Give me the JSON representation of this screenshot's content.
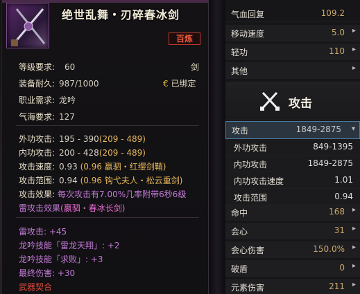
{
  "item": {
    "title": "绝世乱舞・刃碎春冰剑",
    "badge": "百炼",
    "icon": "crossed-swords-icon",
    "level_req_label": "等级要求:",
    "level_req_value": "60",
    "weapon_type": "剑",
    "durability_label": "装备耐久:",
    "durability_value": "987/1000",
    "bound_icon": "lock-icon",
    "bound_text": "已绑定",
    "class_label": "职业需求:",
    "class_value": "龙吟",
    "qi_label": "气海要求:",
    "qi_value": "127",
    "outer_atk_label": "外功攻击:",
    "outer_atk_value": "195 - 390",
    "outer_atk_bonus": "(209 - 489)",
    "inner_atk_label": "内功攻击:",
    "inner_atk_value": "200 - 428",
    "inner_atk_bonus": "(209 - 489)",
    "atk_speed_label": "攻击速度:",
    "atk_speed_value": "0.93",
    "atk_speed_bonus": "(0.96 嬴驷・红缨剑鞘)",
    "atk_range_label": "攻击范围:",
    "atk_range_value": "0.94",
    "atk_range_bonus": "(0.96 钩弋夫人・松云重剑)",
    "atk_effect_label": "攻击效果:",
    "atk_effect_value": "每次攻击有7.00%几率附带6秒6级",
    "atk_effect_line2": "雷攻击效果",
    "atk_effect_source": "(嬴驷・春冰长剑)",
    "thunder_atk": "雷攻击: +45",
    "skill1": "龙吟技能「雷龙天翔」: +2",
    "skill2": "龙吟技能「求败」: +3",
    "final_dmg": "最终伤害: +30",
    "weapon_link": "武器契合"
  },
  "stats_top": [
    {
      "label": "气血回复",
      "value": "109.2"
    },
    {
      "label": "移动速度",
      "value": "5.0"
    },
    {
      "label": "轻功",
      "value": "110"
    },
    {
      "label": "其他",
      "value": ""
    }
  ],
  "section": {
    "label": "攻击",
    "icon": "crossed-swords-icon"
  },
  "attack_selected": {
    "label": "攻击",
    "value": "1849-2875"
  },
  "attack_sub": [
    {
      "label": "外功攻击",
      "value": "849-1395"
    },
    {
      "label": "内功攻击",
      "value": "1849-2875"
    },
    {
      "label": "内功攻击速度",
      "value": "1.01"
    },
    {
      "label": "攻击范围",
      "value": "0.94"
    }
  ],
  "stats_bottom": [
    {
      "label": "命中",
      "value": "168"
    },
    {
      "label": "会心",
      "value": "31"
    },
    {
      "label": "会心伤害",
      "value": "150.0%"
    },
    {
      "label": "破盾",
      "value": "0"
    },
    {
      "label": "元素伤害",
      "value": "211"
    }
  ]
}
